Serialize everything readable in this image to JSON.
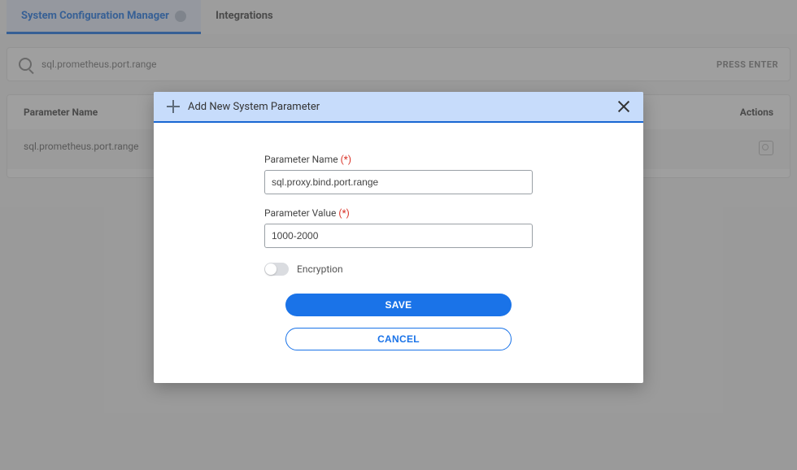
{
  "tabs": {
    "active": "System Configuration Manager",
    "other": "Integrations"
  },
  "search": {
    "value": "sql.prometheus.port.range",
    "action": "PRESS ENTER"
  },
  "table": {
    "headers": {
      "name": "Parameter Name",
      "actions": "Actions"
    },
    "rows": [
      {
        "name": "sql.prometheus.port.range"
      }
    ]
  },
  "modal": {
    "title": "Add New System Parameter",
    "fields": {
      "param_name": {
        "label": "Parameter Name",
        "value": "sql.proxy.bind.port.range"
      },
      "param_value": {
        "label": "Parameter Value",
        "value": "1000-2000"
      }
    },
    "encryption_label": "Encryption",
    "required_mark": "(*)",
    "save_label": "SAVE",
    "cancel_label": "CANCEL"
  }
}
